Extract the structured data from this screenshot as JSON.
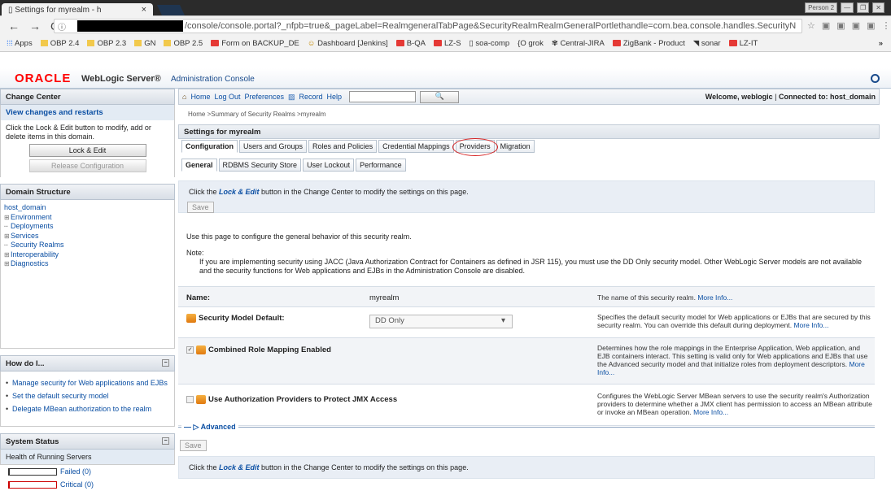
{
  "browser": {
    "tab_title": "Settings for myrealm - h",
    "tab_close": "×",
    "window_user": "Person 2",
    "url": "/console/console.portal?_nfpb=true&_pageLabel=RealmgeneralTabPage&SecurityRealmRealmGeneralPortlethandle=com.bea.console.handles.SecurityN",
    "bookmarks": [
      "Apps",
      "OBP 2.4",
      "OBP 2.3",
      "GN",
      "OBP 2.5",
      "Form on BACKUP_DE",
      "Dashboard [Jenkins]",
      "B-QA",
      "LZ-S",
      "soa-comp",
      "grok",
      "Central-JIRA",
      "ZigBank - Product",
      "sonar",
      "LZ-IT"
    ],
    "more": "»"
  },
  "header": {
    "oracle": "ORACLE",
    "product": "WebLogic Server®",
    "console": "Administration Console"
  },
  "change_center": {
    "title": "Change Center",
    "sub": "View changes and restarts",
    "text": "Click the Lock & Edit button to modify, add or delete items in this domain.",
    "lock": "Lock & Edit",
    "release": "Release Configuration"
  },
  "domain": {
    "title": "Domain Structure",
    "root": "host_domain",
    "items": [
      "Environment",
      "Deployments",
      "Services",
      "Security Realms",
      "Interoperability",
      "Diagnostics"
    ]
  },
  "howto": {
    "title": "How do I...",
    "items": [
      "Manage security for Web applications and EJBs",
      "Set the default security model",
      "Delegate MBean authorization to the realm"
    ]
  },
  "system": {
    "title": "System Status",
    "sub": "Health of Running Servers",
    "rows": [
      "Failed (0)",
      "Critical (0)"
    ]
  },
  "toolbar": {
    "home": "Home",
    "logout": "Log Out",
    "prefs": "Preferences",
    "record": "Record",
    "help": "Help",
    "welcome": "Welcome, weblogic",
    "connected": "Connected to: host_domain"
  },
  "breadcrumb": "Home >Summary of Security Realms >myrealm",
  "settings_title": "Settings for myrealm",
  "tabs": [
    "Configuration",
    "Users and Groups",
    "Roles and Policies",
    "Credential Mappings",
    "Providers",
    "Migration"
  ],
  "subtabs": [
    "General",
    "RDBMS Security Store",
    "User Lockout",
    "Performance"
  ],
  "notice": {
    "pre": "Click the ",
    "link": "Lock & Edit",
    "post": " button in the Change Center to modify the settings on this page.",
    "save": "Save"
  },
  "desc": "Use this page to configure the general behavior of this security realm.",
  "note_label": "Note:",
  "note_body": "If you are implementing security using JACC (Java Authorization Contract for Containers as defined in JSR 115), you must use the DD Only security model. Other WebLogic Server models are not available and the security functions for Web applications and EJBs in the Administration Console are disabled.",
  "props": {
    "name_label": "Name:",
    "name_value": "myrealm",
    "name_help": "The name of this security realm.",
    "more": "More Info...",
    "model_label": "Security Model Default:",
    "model_value": "DD Only",
    "model_help": "Specifies the default security model for Web applications or EJBs that are secured by this security realm. You can override this default during deployment.",
    "combined_label": "Combined Role Mapping Enabled",
    "combined_help": "Determines how the role mappings in the Enterprise Application, Web application, and EJB containers interact. This setting is valid only for Web applications and EJBs that use the Advanced security model and that initialize roles from deployment descriptors.",
    "authz_label": "Use Authorization Providers to Protect JMX Access",
    "authz_help": "Configures the WebLogic Server MBean servers to use the security realm's Authorization providers to determine whether a JMX client has permission to access an MBean attribute or invoke an MBean operation."
  },
  "advanced": "Advanced"
}
